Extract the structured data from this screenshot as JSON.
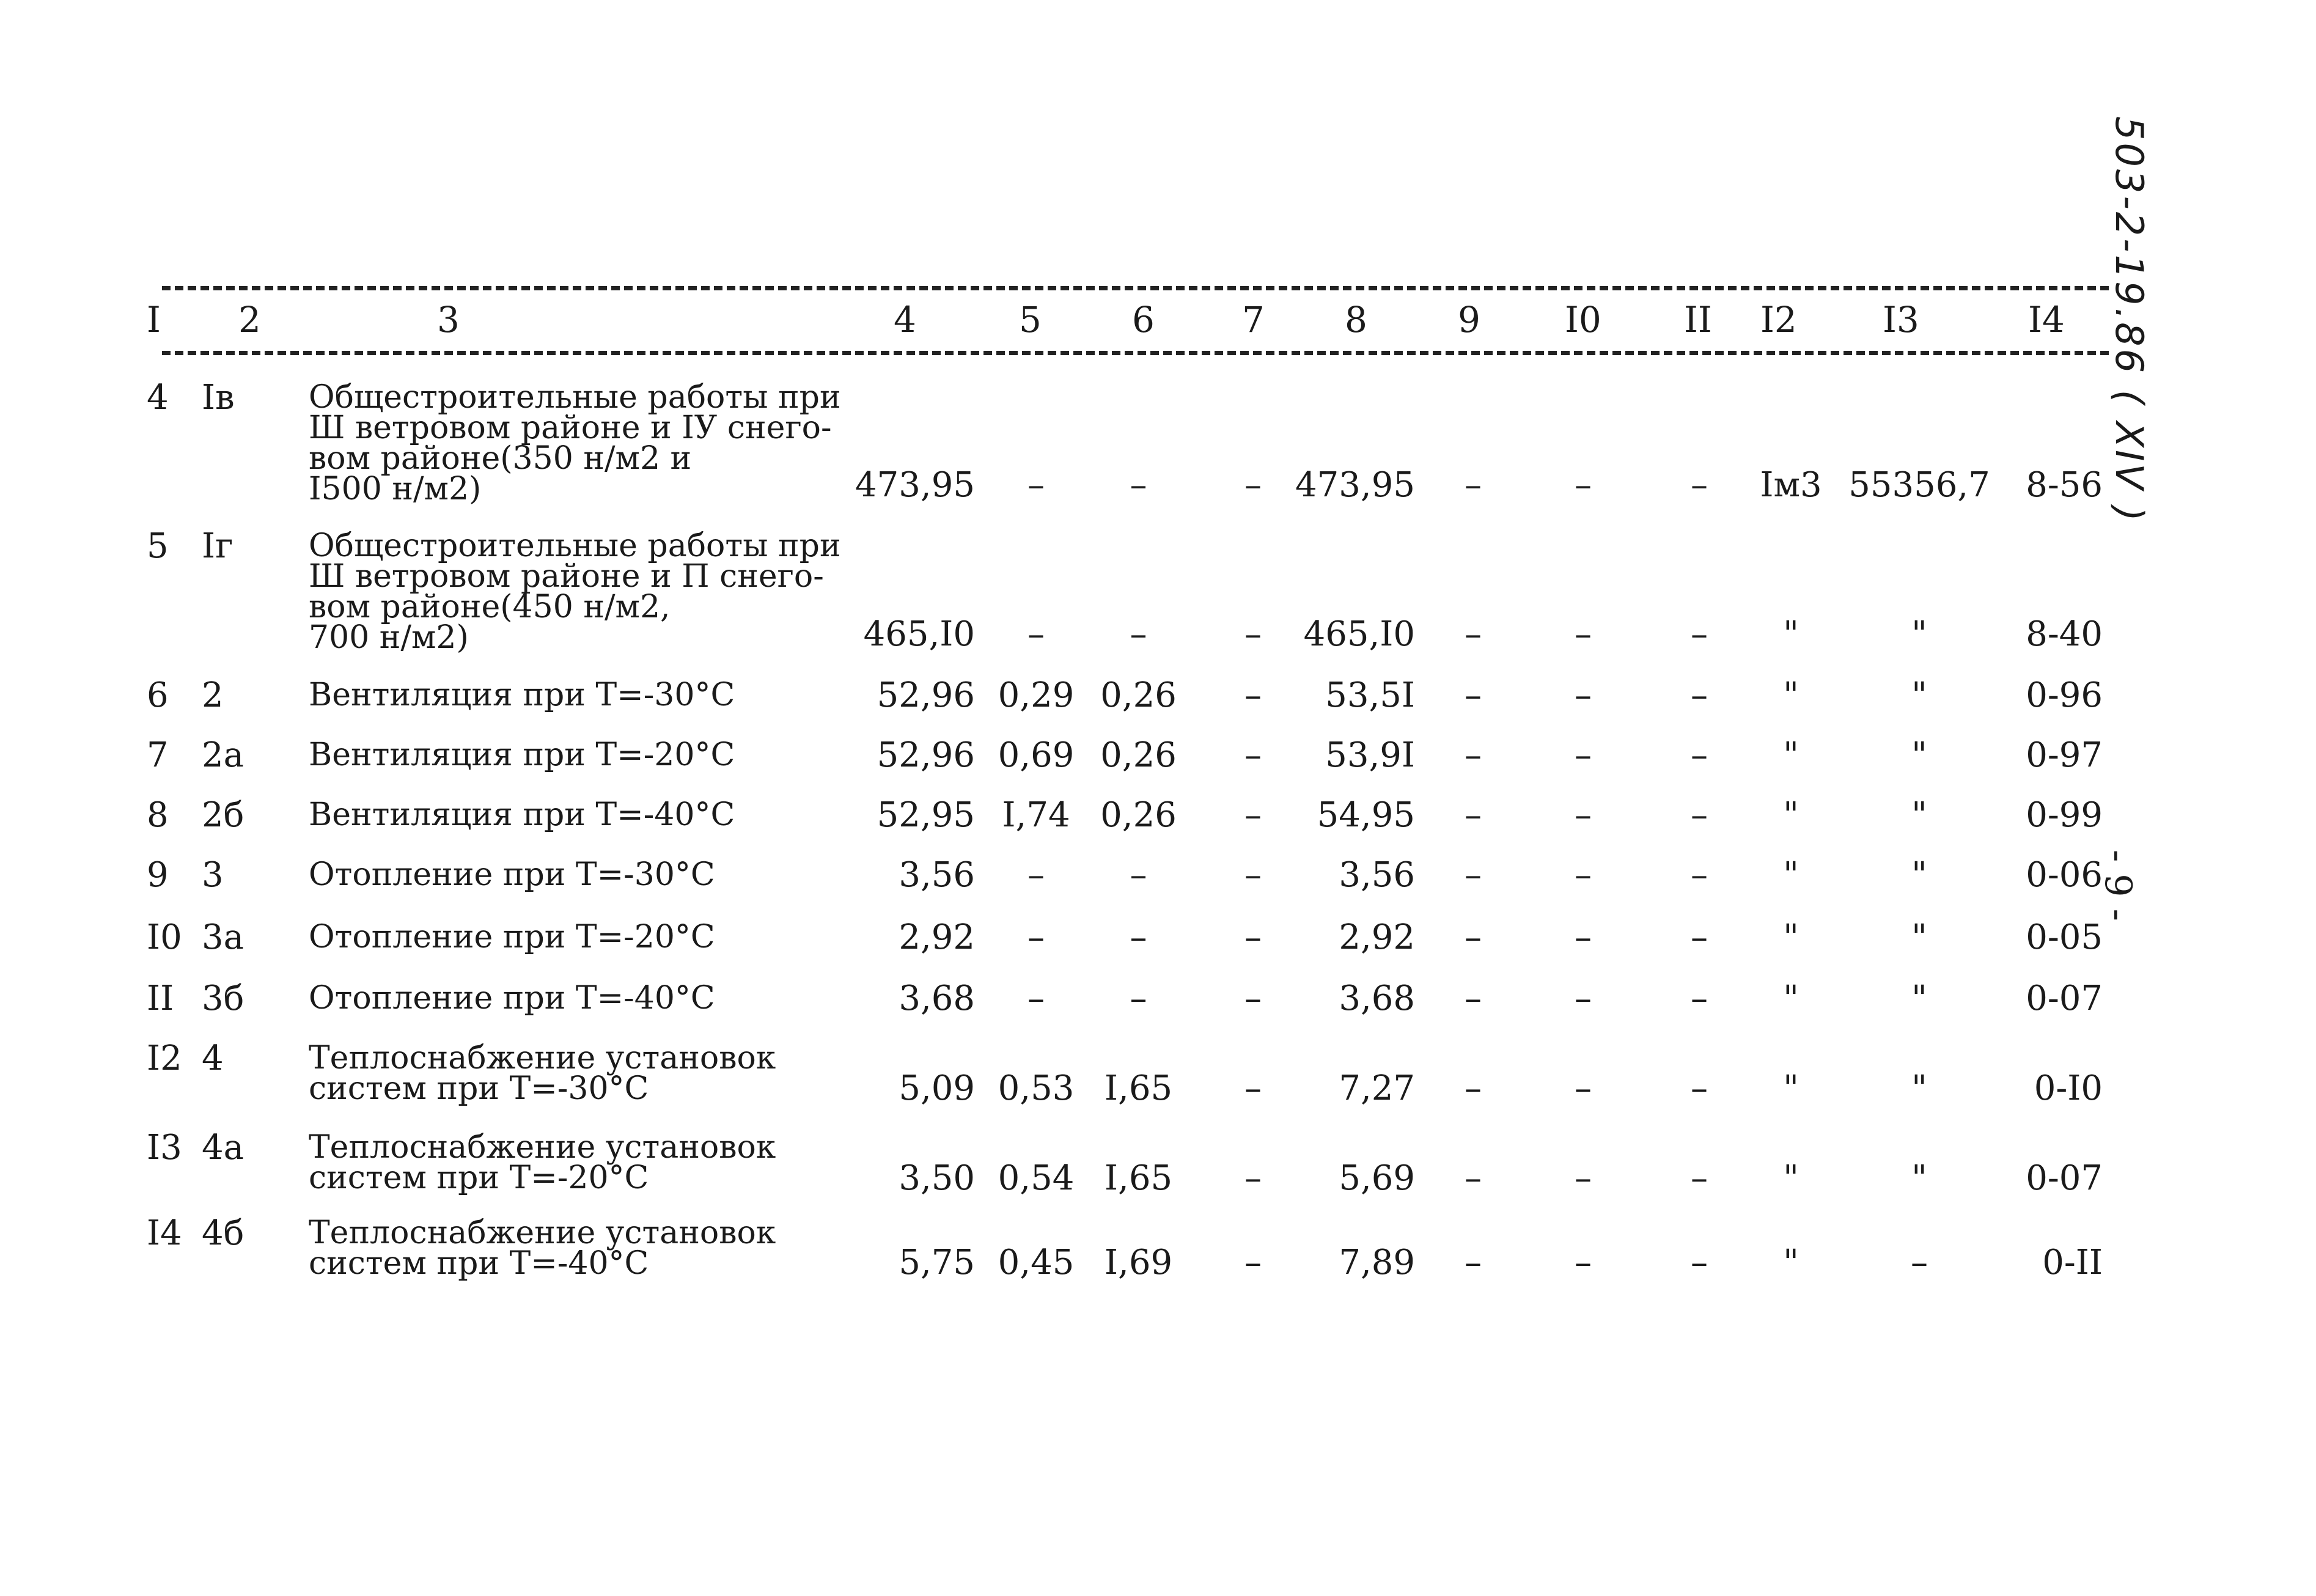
{
  "document": {
    "side_code": "503-2-19.86 ( XIV )",
    "page_number": "- 9 -",
    "header_columns": [
      "I",
      "2",
      "3",
      "4",
      "5",
      "6",
      "7",
      "8",
      "9",
      "I0",
      "II",
      "I2",
      "I3",
      "I4"
    ],
    "rows": [
      {
        "c1": "4",
        "c2": "Iв",
        "c3": "Общестроительные работы при\nШ ветровом районе и IУ снего-\nвом районе(350 н/м2 и\nI500 н/м2)",
        "c4": "473,95",
        "c5": "–",
        "c6": "–",
        "c7": "–",
        "c8": "473,95",
        "c9": "–",
        "c10": "–",
        "c11": "–",
        "c12": "Iм3",
        "c13": "55356,7",
        "c14": "8-56"
      },
      {
        "c1": "5",
        "c2": "Iг",
        "c3": "Общестроительные работы при\nШ ветровом районе и П снего-\nвом районе(450 н/м2,\n700 н/м2)",
        "c4": "465,I0",
        "c5": "–",
        "c6": "–",
        "c7": "–",
        "c8": "465,I0",
        "c9": "–",
        "c10": "–",
        "c11": "–",
        "c12": "\"",
        "c13": "\"",
        "c14": "8-40"
      },
      {
        "c1": "6",
        "c2": "2",
        "c3": "Вентиляция при Т=-30°С",
        "c4": "52,96",
        "c5": "0,29",
        "c6": "0,26",
        "c7": "–",
        "c8": "53,5I",
        "c9": "–",
        "c10": "–",
        "c11": "–",
        "c12": "\"",
        "c13": "\"",
        "c14": "0-96"
      },
      {
        "c1": "7",
        "c2": "2а",
        "c3": "Вентиляция при Т=-20°С",
        "c4": "52,96",
        "c5": "0,69",
        "c6": "0,26",
        "c7": "–",
        "c8": "53,9I",
        "c9": "–",
        "c10": "–",
        "c11": "–",
        "c12": "\"",
        "c13": "\"",
        "c14": "0-97"
      },
      {
        "c1": "8",
        "c2": "2б",
        "c3": "Вентиляция при Т=-40°С",
        "c4": "52,95",
        "c5": "I,74",
        "c6": "0,26",
        "c7": "–",
        "c8": "54,95",
        "c9": "–",
        "c10": "–",
        "c11": "–",
        "c12": "\"",
        "c13": "\"",
        "c14": "0-99"
      },
      {
        "c1": "9",
        "c2": "3",
        "c3": "Отопление при Т=-30°С",
        "c4": "3,56",
        "c5": "–",
        "c6": "–",
        "c7": "–",
        "c8": "3,56",
        "c9": "–",
        "c10": "–",
        "c11": "–",
        "c12": "\"",
        "c13": "\"",
        "c14": "0-06"
      },
      {
        "c1": "I0",
        "c2": "3а",
        "c3": "Отопление при Т=-20°С",
        "c4": "2,92",
        "c5": "–",
        "c6": "–",
        "c7": "–",
        "c8": "2,92",
        "c9": "–",
        "c10": "–",
        "c11": "–",
        "c12": "\"",
        "c13": "\"",
        "c14": "0-05"
      },
      {
        "c1": "II",
        "c2": "3б",
        "c3": "Отопление при Т=-40°С",
        "c4": "3,68",
        "c5": "–",
        "c6": "–",
        "c7": "–",
        "c8": "3,68",
        "c9": "–",
        "c10": "–",
        "c11": "–",
        "c12": "\"",
        "c13": "\"",
        "c14": "0-07"
      },
      {
        "c1": "I2",
        "c2": "4",
        "c3": "Теплоснабжение установок\nсистем при Т=-30°С",
        "c4": "5,09",
        "c5": "0,53",
        "c6": "I,65",
        "c7": "–",
        "c8": "7,27",
        "c9": "–",
        "c10": "–",
        "c11": "–",
        "c12": "\"",
        "c13": "\"",
        "c14": "0-I0"
      },
      {
        "c1": "I3",
        "c2": "4а",
        "c3": "Теплоснабжение установок\nсистем при Т=-20°С",
        "c4": "3,50",
        "c5": "0,54",
        "c6": "I,65",
        "c7": "–",
        "c8": "5,69",
        "c9": "–",
        "c10": "–",
        "c11": "–",
        "c12": "\"",
        "c13": "\"",
        "c14": "0-07"
      },
      {
        "c1": "I4",
        "c2": "4б",
        "c3": "Теплоснабжение установок\nсистем при Т=-40°С",
        "c4": "5,75",
        "c5": "0,45",
        "c6": "I,69",
        "c7": "–",
        "c8": "7,89",
        "c9": "–",
        "c10": "–",
        "c11": "–",
        "c12": "\"",
        "c13": "–",
        "c14": "0-II"
      }
    ]
  }
}
